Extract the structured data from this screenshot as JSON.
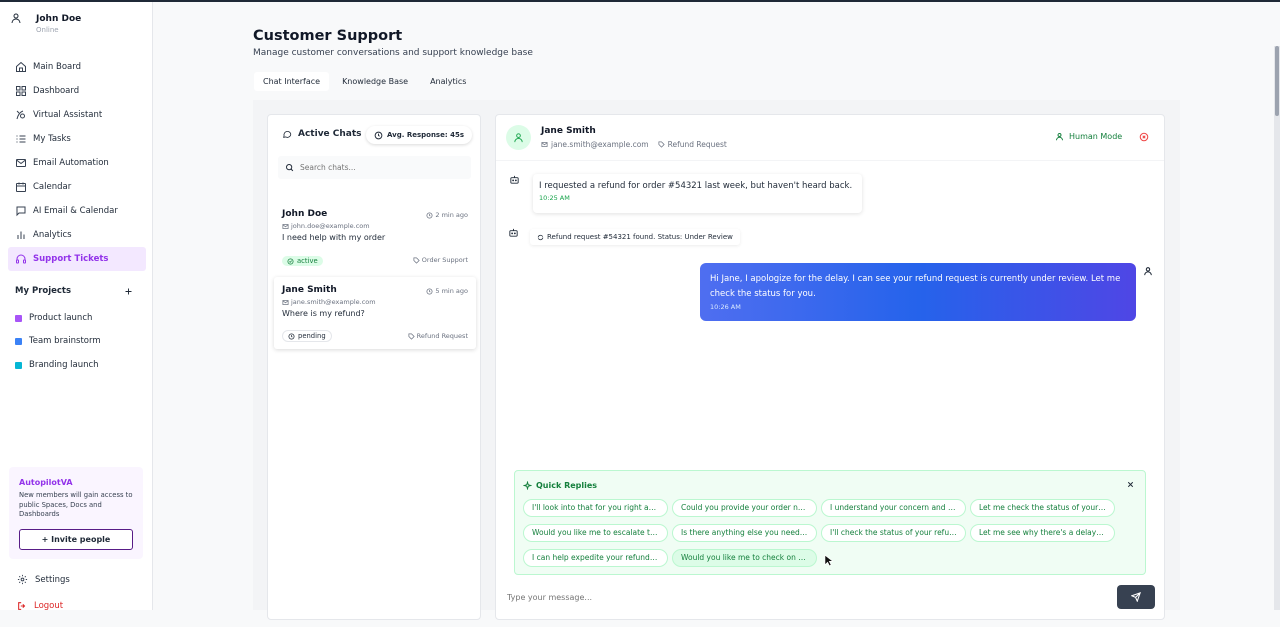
{
  "user": {
    "name": "John Doe",
    "status": "Online"
  },
  "nav": [
    {
      "label": "Main Board",
      "icon": "home-icon"
    },
    {
      "label": "Dashboard",
      "icon": "grid-icon"
    },
    {
      "label": "Virtual Assistant",
      "icon": "assistant-icon"
    },
    {
      "label": "My Tasks",
      "icon": "list-icon"
    },
    {
      "label": "Email Automation",
      "icon": "mail-icon"
    },
    {
      "label": "Calendar",
      "icon": "calendar-icon"
    },
    {
      "label": "AI Email & Calendar",
      "icon": "chat-icon"
    },
    {
      "label": "Analytics",
      "icon": "bar-chart-icon"
    },
    {
      "label": "Support Tickets",
      "icon": "headset-icon",
      "active": true
    }
  ],
  "projects": {
    "title": "My Projects",
    "items": [
      {
        "label": "Product launch",
        "color": "#a855f7"
      },
      {
        "label": "Team brainstorm",
        "color": "#3b82f6"
      },
      {
        "label": "Branding launch",
        "color": "#06b6d4"
      }
    ]
  },
  "promo": {
    "title": "AutopilotVA",
    "text": "New members will gain access to public Spaces, Docs and Dashboards",
    "button": "+ Invite people"
  },
  "footer": {
    "settings": "Settings",
    "logout": "Logout"
  },
  "header": {
    "title": "Customer Support",
    "subtitle": "Manage customer conversations and support knowledge base",
    "tabs": [
      "Chat Interface",
      "Knowledge Base",
      "Analytics"
    ]
  },
  "chat_list": {
    "title": "Active Chats",
    "avg_response": "Avg. Response: 45s",
    "search_placeholder": "Search chats...",
    "chats": [
      {
        "name": "John Doe",
        "time": "2 min ago",
        "email": "john.doe@example.com",
        "message": "I need help with my order",
        "status": "active",
        "tag": "Order Support"
      },
      {
        "name": "Jane Smith",
        "time": "5 min ago",
        "email": "jane.smith@example.com",
        "message": "Where is my refund?",
        "status": "pending",
        "tag": "Refund Request"
      }
    ]
  },
  "conversation": {
    "name": "Jane Smith",
    "email": "jane.smith@example.com",
    "tag": "Refund Request",
    "mode": "Human Mode",
    "messages": [
      {
        "text": "I requested a refund for order #54321 last week, but haven't heard back.",
        "time": "10:25 AM"
      },
      {
        "text": "Refund request #54321 found. Status: Under Review"
      },
      {
        "text": "Hi Jane, I apologize for the delay. I can see your refund request is currently under review. Let me check the status for you.",
        "time": "10:26 AM"
      }
    ]
  },
  "quick_replies": {
    "title": "Quick Replies",
    "items": [
      "I'll look into that for you right away.",
      "Could you provide your order number?",
      "I understand your concern and apologize.",
      "Let me check the status of your request.",
      "Would you like me to escalate this issue?",
      "Is there anything else you need help with?",
      "I'll check the status of your refund now.",
      "Let me see why there's a delay with this.",
      "I can help expedite your refund process.",
      "Would you like me to check on that?"
    ]
  },
  "composer": {
    "placeholder": "Type your message..."
  }
}
